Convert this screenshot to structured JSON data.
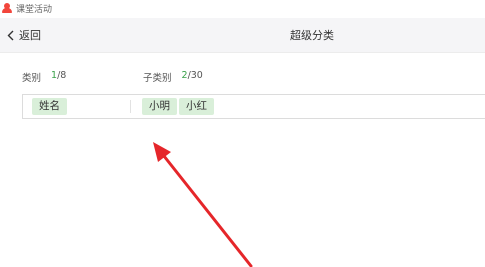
{
  "window": {
    "app_name": "课堂活动",
    "icon": "user-icon"
  },
  "nav": {
    "back_label": "返回",
    "back_icon": "chevron-left-icon",
    "title": "超级分类"
  },
  "header": {
    "category_label": "类别",
    "category_count_current": "1",
    "category_count_total": "/8",
    "sub_label": "子类别",
    "sub_count_current": "2",
    "sub_count_total": "/30"
  },
  "row": {
    "category": "姓名",
    "subcategories": [
      "小明",
      "小红"
    ]
  },
  "annotation": {
    "type": "red-arrow-pointer",
    "color": "#e5262a"
  },
  "colors": {
    "chip_bg": "#d9efd9",
    "count_accent": "#3aa14a",
    "logo": "#f2463c"
  }
}
